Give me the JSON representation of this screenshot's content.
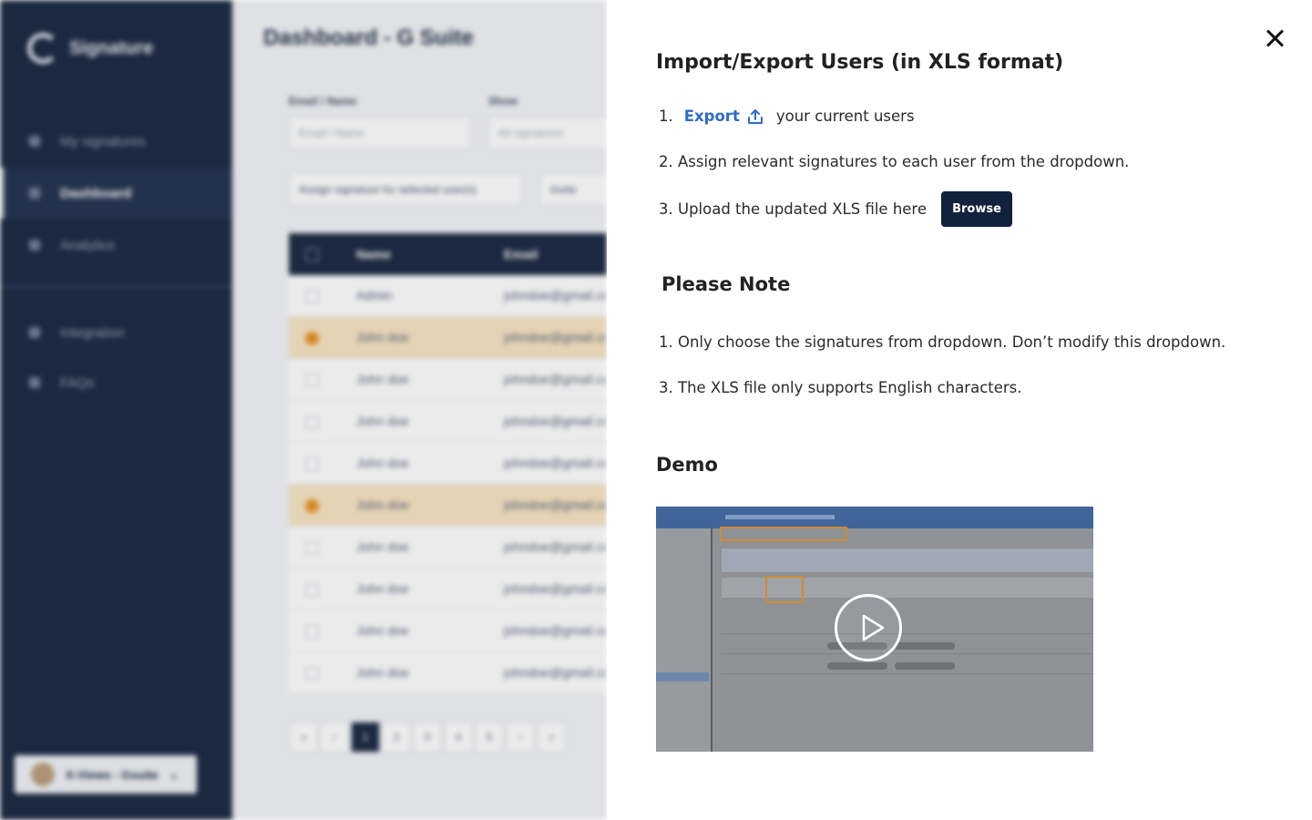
{
  "background": {
    "app_name": "Signature",
    "page_title": "Dashboard - G Suite",
    "nav": [
      {
        "label": "My signatures",
        "icon": "signature-icon"
      },
      {
        "label": "Dashboard",
        "icon": "dashboard-icon",
        "active": true
      },
      {
        "label": "Analytics",
        "icon": "analytics-icon"
      },
      {
        "label": "Integration",
        "icon": "integration-icon"
      },
      {
        "label": "FAQs",
        "icon": "faq-icon"
      }
    ],
    "account_label": "X-Views - Gsuite",
    "filters": {
      "email_label": "Email / Name",
      "email_placeholder": "Email / Name",
      "show_label": "Show",
      "show_value": "All signatures"
    },
    "assign_placeholder": "Assign signature for selected user(s)",
    "invite_label": "Invite",
    "table": {
      "headers": [
        "Name",
        "Email"
      ],
      "rows": [
        {
          "name": "Admin",
          "email": "johndoe@gmail.com",
          "selected": false
        },
        {
          "name": "John doe",
          "email": "johndoe@gmail.com",
          "selected": true
        },
        {
          "name": "John doe",
          "email": "johndoe@gmail.com",
          "selected": false
        },
        {
          "name": "John doe",
          "email": "johndoe@gmail.com",
          "selected": false
        },
        {
          "name": "John doe",
          "email": "johndoe@gmail.com",
          "selected": false
        },
        {
          "name": "John doe",
          "email": "johndoe@gmail.com",
          "selected": true
        },
        {
          "name": "John doe",
          "email": "johndoe@gmail.com",
          "selected": false
        },
        {
          "name": "John doe",
          "email": "johndoe@gmail.com",
          "selected": false
        },
        {
          "name": "John doe",
          "email": "johndoe@gmail.com",
          "selected": false
        },
        {
          "name": "John doe",
          "email": "johndoe@gmail.com",
          "selected": false
        }
      ]
    },
    "pagination": [
      "«",
      "‹",
      "1",
      "2",
      "3",
      "4",
      "5",
      "›",
      "»"
    ],
    "current_page": "1"
  },
  "panel": {
    "title": "Import/Export Users (in XLS format)",
    "close_icon": "close-icon",
    "steps": {
      "s1_num": "1.",
      "s1_link": "Export",
      "s1_link_icon": "upload-icon",
      "s1_text": "your current users",
      "s2": "2. Assign relevant signatures to each user from the dropdown.",
      "s3": "3. Upload the updated XLS file here",
      "browse_label": "Browse"
    },
    "note_title": "Please Note",
    "notes": [
      "1. Only choose the signatures from dropdown. Don’t modify this dropdown.",
      "3. The XLS file only supports English characters."
    ],
    "demo_title": "Demo",
    "video_play_icon": "play-icon"
  },
  "colors": {
    "navy": "#13213d",
    "link_blue": "#2f6bc8",
    "selected_row": "#f8e4c2",
    "orange": "#e98e1c"
  }
}
